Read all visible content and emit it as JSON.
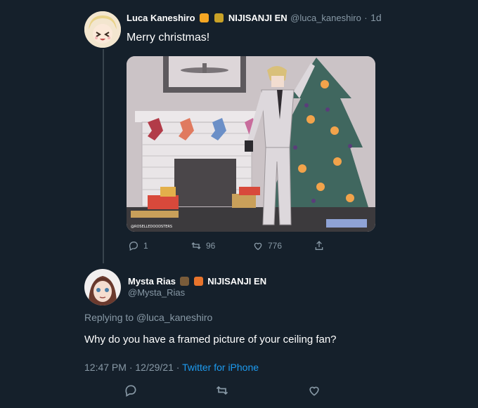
{
  "tweet1": {
    "author_name": "Luca Kaneshiro",
    "affiliation": "NIJISANJI EN",
    "handle": "@luca_kaneshiro",
    "age": "1d",
    "text": "Merry christmas!",
    "image_watermark": "@ROSELLEDOODSTERS",
    "stats": {
      "replies": "1",
      "retweets": "96",
      "likes": "776"
    },
    "icons": [
      "reply-icon",
      "retweet-icon",
      "like-icon",
      "share-icon"
    ]
  },
  "tweet2": {
    "author_name": "Mysta Rias",
    "affiliation": "NIJISANJI EN",
    "handle": "@Mysta_Rias",
    "replying_prefix": "Replying to",
    "replying_to": "@luca_kaneshiro",
    "text": "Why do you have a framed picture of your ceiling fan?",
    "time": "12:47 PM",
    "separator": "·",
    "date": "12/29/21",
    "source": "Twitter for iPhone",
    "icons": [
      "reply-icon",
      "retweet-icon",
      "like-icon"
    ]
  },
  "colors": {
    "background": "#15202b",
    "secondary_text": "#8899a6",
    "link": "#1d9bf0",
    "line": "#38444d"
  }
}
